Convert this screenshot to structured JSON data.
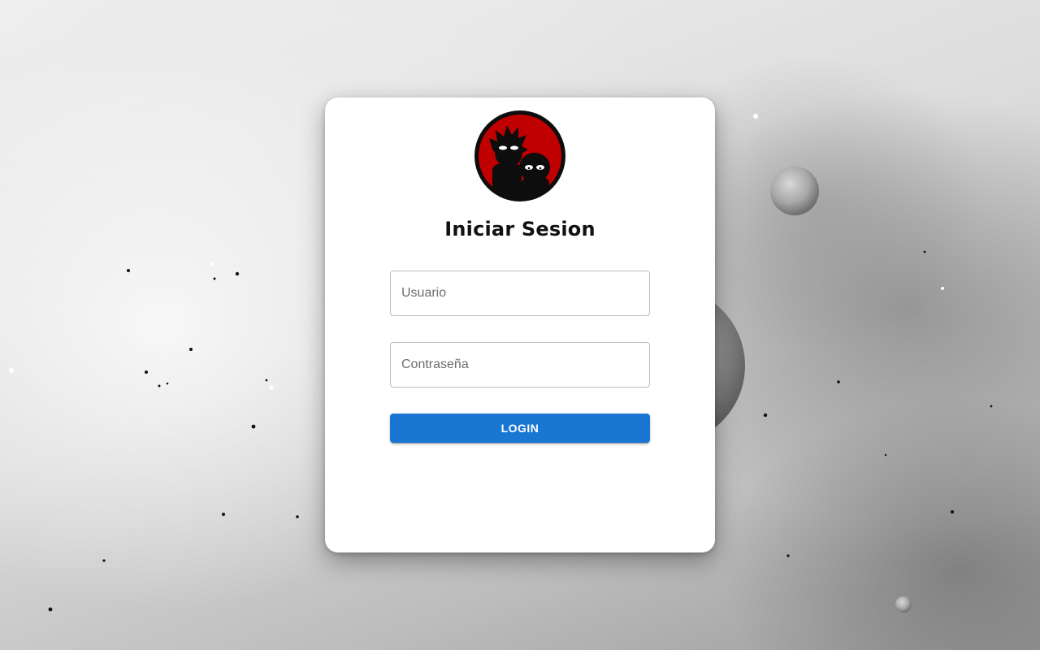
{
  "login": {
    "title": "Iniciar Sesion",
    "username_placeholder": "Usuario",
    "password_placeholder": "Contraseña",
    "button_label": "LOGIN"
  },
  "avatar": {
    "icon": "rick-and-morty-silhouette-icon",
    "bg_color": "#c00000"
  },
  "theme": {
    "accent": "#1976d2",
    "card_bg": "#ffffff"
  }
}
